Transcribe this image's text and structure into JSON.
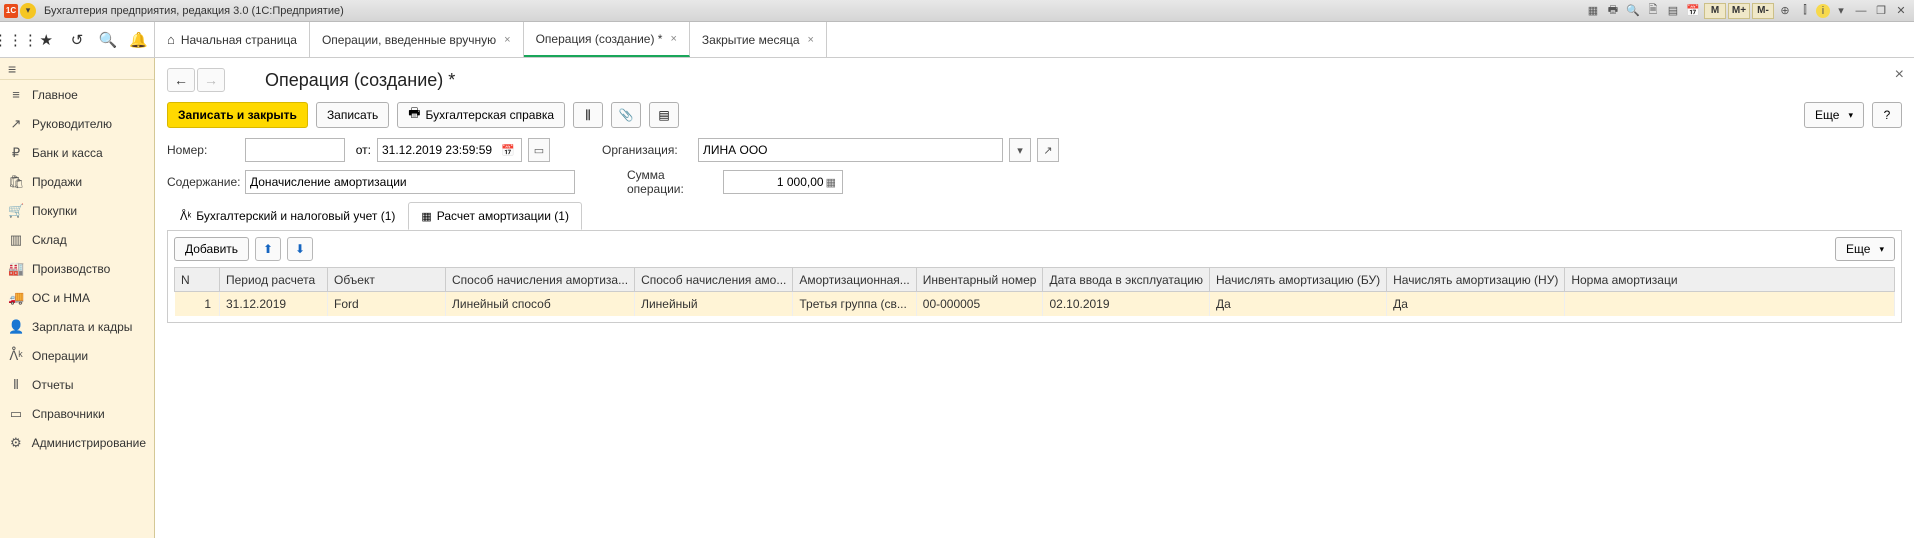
{
  "window_title": "Бухгалтерия предприятия, редакция 3.0  (1С:Предприятие)",
  "title_icons": [
    "M",
    "M+",
    "M-"
  ],
  "tabs": [
    {
      "label": "Начальная страница",
      "home": true,
      "closable": false
    },
    {
      "label": "Операции, введенные вручную",
      "closable": true
    },
    {
      "label": "Операция (создание) *",
      "closable": true,
      "active": true
    },
    {
      "label": "Закрытие месяца",
      "closable": true
    }
  ],
  "sidebar": [
    {
      "icon": "≡",
      "label": "Главное"
    },
    {
      "icon": "↗",
      "label": "Руководителю"
    },
    {
      "icon": "₽",
      "label": "Банк и касса"
    },
    {
      "icon": "🛍",
      "label": "Продажи"
    },
    {
      "icon": "🛒",
      "label": "Покупки"
    },
    {
      "icon": "▥",
      "label": "Склад"
    },
    {
      "icon": "🏭",
      "label": "Производство"
    },
    {
      "icon": "🚚",
      "label": "ОС и НМА"
    },
    {
      "icon": "👤",
      "label": "Зарплата и кадры"
    },
    {
      "icon": "ᐰᵏ",
      "label": "Операции"
    },
    {
      "icon": "⫴",
      "label": "Отчеты"
    },
    {
      "icon": "▭",
      "label": "Справочники"
    },
    {
      "icon": "⚙",
      "label": "Администрирование"
    }
  ],
  "page": {
    "title": "Операция (создание) *",
    "buttons": {
      "save_close": "Записать и закрыть",
      "save": "Записать",
      "accounting_ref": "Бухгалтерская справка",
      "more": "Еще",
      "help": "?",
      "add": "Добавить"
    },
    "labels": {
      "number": "Номер:",
      "from": "от:",
      "organization": "Организация:",
      "content": "Содержание:",
      "operation_sum": "Сумма операции:"
    },
    "values": {
      "number": "",
      "date": "31.12.2019 23:59:59",
      "organization": "ЛИНА ООО",
      "content": "Доначисление амортизации",
      "sum": "1 000,00"
    },
    "sub_tabs": [
      {
        "label": "Бухгалтерский и налоговый учет (1)"
      },
      {
        "label": "Расчет амортизации (1)",
        "active": true
      }
    ],
    "table": {
      "columns": [
        "N",
        "Период расчета",
        "Объект",
        "Способ начисления амортиза...",
        "Способ начисления амо...",
        "Амортизационная...",
        "Инвентарный номер",
        "Дата ввода в эксплуатацию",
        "Начислять амортизацию (БУ)",
        "Начислять амортизацию (НУ)",
        "Норма амортизаци"
      ],
      "rows": [
        {
          "n": "1",
          "period": "31.12.2019",
          "object": "Ford",
          "method_bu": "Линейный способ",
          "method_nu": "Линейный",
          "group": "Третья группа (св...",
          "inv": "00-000005",
          "date": "02.10.2019",
          "calc_bu": "Да",
          "calc_nu": "Да",
          "norm": ""
        }
      ]
    }
  }
}
